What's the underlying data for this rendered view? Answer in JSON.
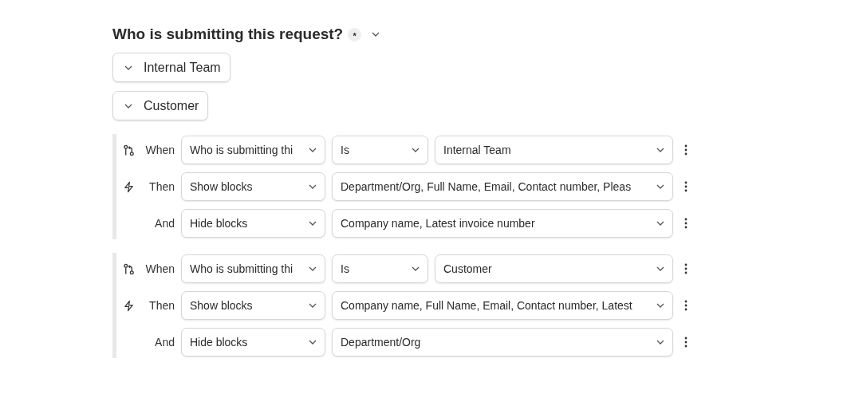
{
  "question": {
    "title": "Who is submitting this request?",
    "required_mark": "*",
    "options": [
      {
        "label": "Internal Team"
      },
      {
        "label": "Customer"
      }
    ]
  },
  "rules": [
    {
      "rows": [
        {
          "kind": "condition",
          "label": "When",
          "selects": [
            "Who is submitting thi",
            "Is",
            "Internal Team"
          ]
        },
        {
          "kind": "action",
          "label": "Then",
          "selects": [
            "Show blocks",
            "Department/Org, Full Name, Email, Contact number, Pleas"
          ]
        },
        {
          "kind": "and",
          "label": "And",
          "selects": [
            "Hide blocks",
            "Company name, Latest invoice number"
          ]
        }
      ]
    },
    {
      "rows": [
        {
          "kind": "condition",
          "label": "When",
          "selects": [
            "Who is submitting thi",
            "Is",
            "Customer"
          ]
        },
        {
          "kind": "action",
          "label": "Then",
          "selects": [
            "Show blocks",
            "Company name, Full Name, Email, Contact number, Latest"
          ]
        },
        {
          "kind": "and",
          "label": "And",
          "selects": [
            "Hide blocks",
            "Department/Org"
          ]
        }
      ]
    }
  ]
}
